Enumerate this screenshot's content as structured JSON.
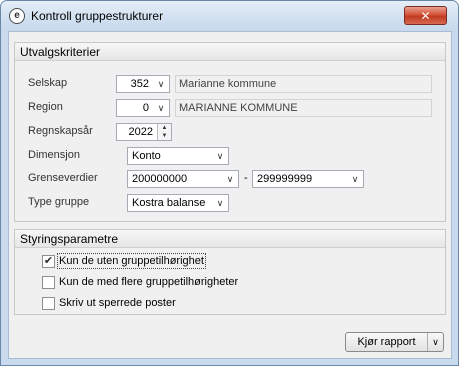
{
  "window": {
    "title": "Kontroll gruppestrukturer",
    "app_icon": "e-logo-icon",
    "close_symbol": "✕"
  },
  "criteria": {
    "header": "Utvalgskriterier",
    "selskap": {
      "label": "Selskap",
      "value": "352",
      "description": "Marianne kommune"
    },
    "region": {
      "label": "Region",
      "value": "0",
      "description": "MARIANNE KOMMUNE"
    },
    "regnskapsar": {
      "label": "Regnskapsår",
      "value": "2022"
    },
    "dimensjon": {
      "label": "Dimensjon",
      "value": "Konto"
    },
    "grenseverdier": {
      "label": "Grenseverdier",
      "from": "200000000",
      "separator": "-",
      "to": "299999999"
    },
    "type_gruppe": {
      "label": "Type gruppe",
      "value": "Kostra balanse"
    }
  },
  "params": {
    "header": "Styringsparametre",
    "options": [
      {
        "label": "Kun de uten gruppetilhørighet",
        "checked": true
      },
      {
        "label": "Kun de med flere gruppetilhørigheter",
        "checked": false
      },
      {
        "label": "Skriv ut sperrede poster",
        "checked": false
      }
    ]
  },
  "actions": {
    "run_report": "Kjør rapport"
  },
  "icons": {
    "dropdown": "chevron-down-icon",
    "spin_up": "spin-up-icon",
    "spin_down": "spin-down-icon",
    "check": "checkmark-icon"
  }
}
